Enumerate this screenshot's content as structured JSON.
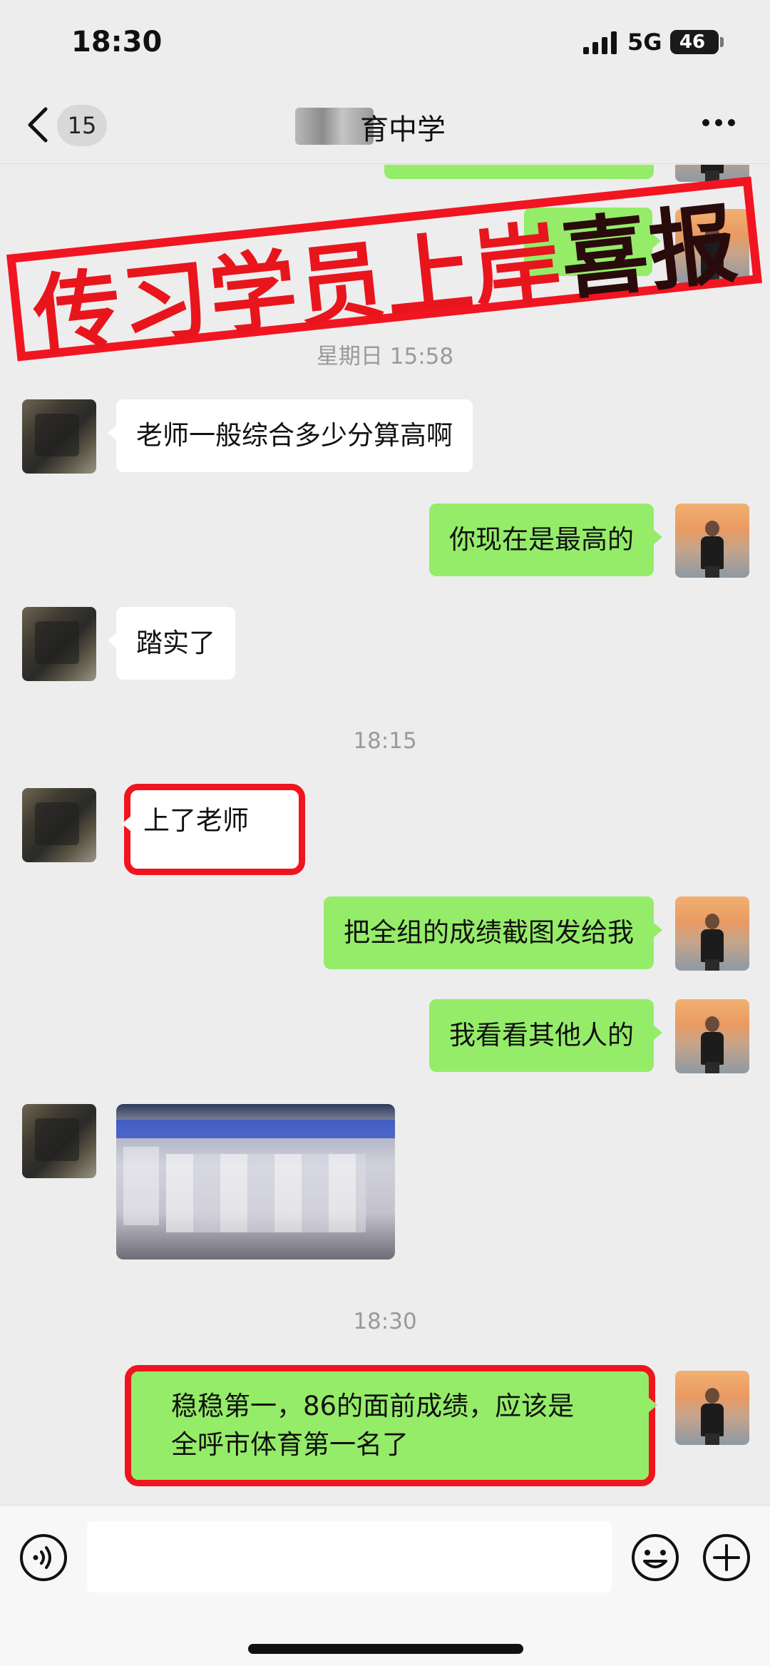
{
  "status_bar": {
    "time": "18:30",
    "network": "5G",
    "battery": "46"
  },
  "nav": {
    "unread_count": "15",
    "title_visible": "育中学",
    "back_icon": "chevron-left-icon",
    "more_icon": "more-dots-icon"
  },
  "banner": {
    "text_red": "传习学员上岸",
    "text_dark": "喜报"
  },
  "messages": {
    "ts1": "星期日 15:58",
    "m1": "老师一般综合多少分算高啊",
    "m2": "你现在是最高的",
    "m3": "踏实了",
    "ts2": "18:15",
    "m4": "上了老师",
    "m5": "把全组的成绩截图发给我",
    "m6": "我看看其他人的",
    "ts3": "18:30",
    "m8": "稳稳第一，86的面前成绩，应该是\n全呼市体育第一名了"
  },
  "input": {
    "value": ""
  },
  "colors": {
    "self_bubble": "#95ec69",
    "other_bubble": "#ffffff",
    "highlight_red": "#f0141e",
    "background": "#ededed"
  }
}
